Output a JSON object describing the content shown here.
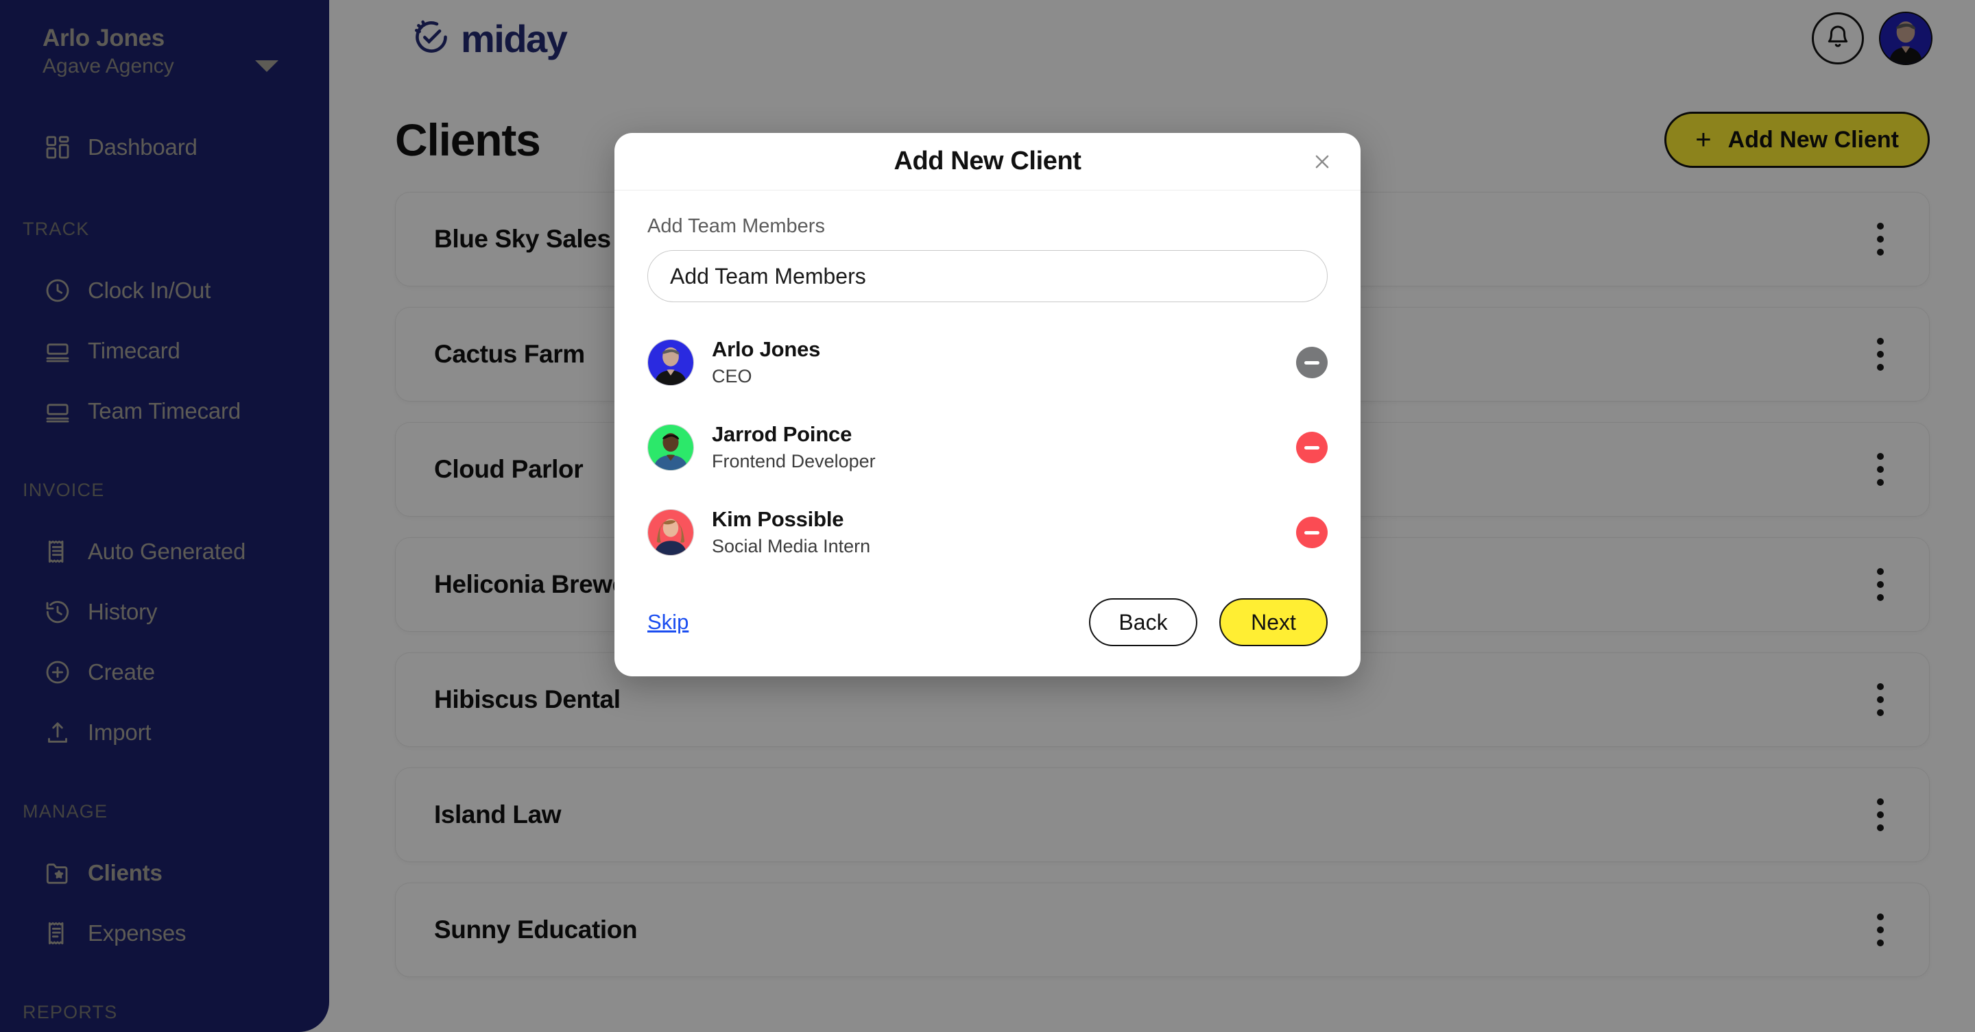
{
  "sidebar": {
    "user": {
      "name": "Arlo Jones",
      "org": "Agave Agency",
      "caret_icon": "chevron-down-icon"
    },
    "top_items": [
      {
        "label": "Dashboard",
        "icon": "dashboard-grid-icon",
        "active": false
      }
    ],
    "sections": [
      {
        "title": "TRACK",
        "items": [
          {
            "label": "Clock In/Out",
            "icon": "clock-icon",
            "active": false
          },
          {
            "label": "Timecard",
            "icon": "timecard-icon",
            "active": false
          },
          {
            "label": "Team Timecard",
            "icon": "timecard-icon",
            "active": false
          }
        ]
      },
      {
        "title": "INVOICE",
        "items": [
          {
            "label": "Auto Generated",
            "icon": "receipt-icon",
            "active": false
          },
          {
            "label": "History",
            "icon": "history-clock-icon",
            "active": false
          },
          {
            "label": "Create",
            "icon": "plus-circle-icon",
            "active": false
          },
          {
            "label": "Import",
            "icon": "upload-icon",
            "active": false
          }
        ]
      },
      {
        "title": "MANAGE",
        "items": [
          {
            "label": "Clients",
            "icon": "folder-star-icon",
            "active": true
          },
          {
            "label": "Expenses",
            "icon": "receipt-list-icon",
            "active": false
          }
        ]
      },
      {
        "title": "REPORTS",
        "items": []
      }
    ]
  },
  "topbar": {
    "logo_text": "miday",
    "logo_icon": "clock-check-icon",
    "notifications_icon": "bell-icon",
    "avatar_icon": "user-avatar"
  },
  "main": {
    "page_title": "Clients",
    "add_button": {
      "label": "Add New Client",
      "icon": "plus-icon"
    },
    "clients": [
      {
        "name": "Blue Sky Sales",
        "menu_icon": "kebab-menu-icon"
      },
      {
        "name": "Cactus Farm",
        "menu_icon": "kebab-menu-icon"
      },
      {
        "name": "Cloud Parlor",
        "menu_icon": "kebab-menu-icon"
      },
      {
        "name": "Heliconia Brewery",
        "menu_icon": "kebab-menu-icon"
      },
      {
        "name": "Hibiscus Dental",
        "menu_icon": "kebab-menu-icon"
      },
      {
        "name": "Island Law",
        "menu_icon": "kebab-menu-icon"
      },
      {
        "name": "Sunny Education",
        "menu_icon": "kebab-menu-icon"
      }
    ]
  },
  "modal": {
    "title": "Add New Client",
    "close_icon": "close-icon",
    "field_label": "Add Team Members",
    "input_placeholder": "Add Team Members",
    "input_value": "",
    "members": [
      {
        "name": "Arlo Jones",
        "role": "CEO",
        "avatar_bg": "#2a2ae0",
        "remove_color": "#77787a",
        "remove_icon": "minus-circle-icon"
      },
      {
        "name": "Jarrod Poince",
        "role": "Frontend Developer",
        "avatar_bg": "#2ce86a",
        "remove_color": "#fb4b53",
        "remove_icon": "minus-circle-icon"
      },
      {
        "name": "Kim Possible",
        "role": "Social Media Intern",
        "avatar_bg": "#f9545c",
        "remove_color": "#fb4b53",
        "remove_icon": "minus-circle-icon"
      }
    ],
    "skip_label": "Skip",
    "back_label": "Back",
    "next_label": "Next"
  },
  "colors": {
    "sidebar_bg": "#1c216e",
    "brand_navy": "#232a74",
    "accent_yellow": "#ffee33",
    "link_blue": "#1a4df0",
    "danger_red": "#fb4b53"
  }
}
